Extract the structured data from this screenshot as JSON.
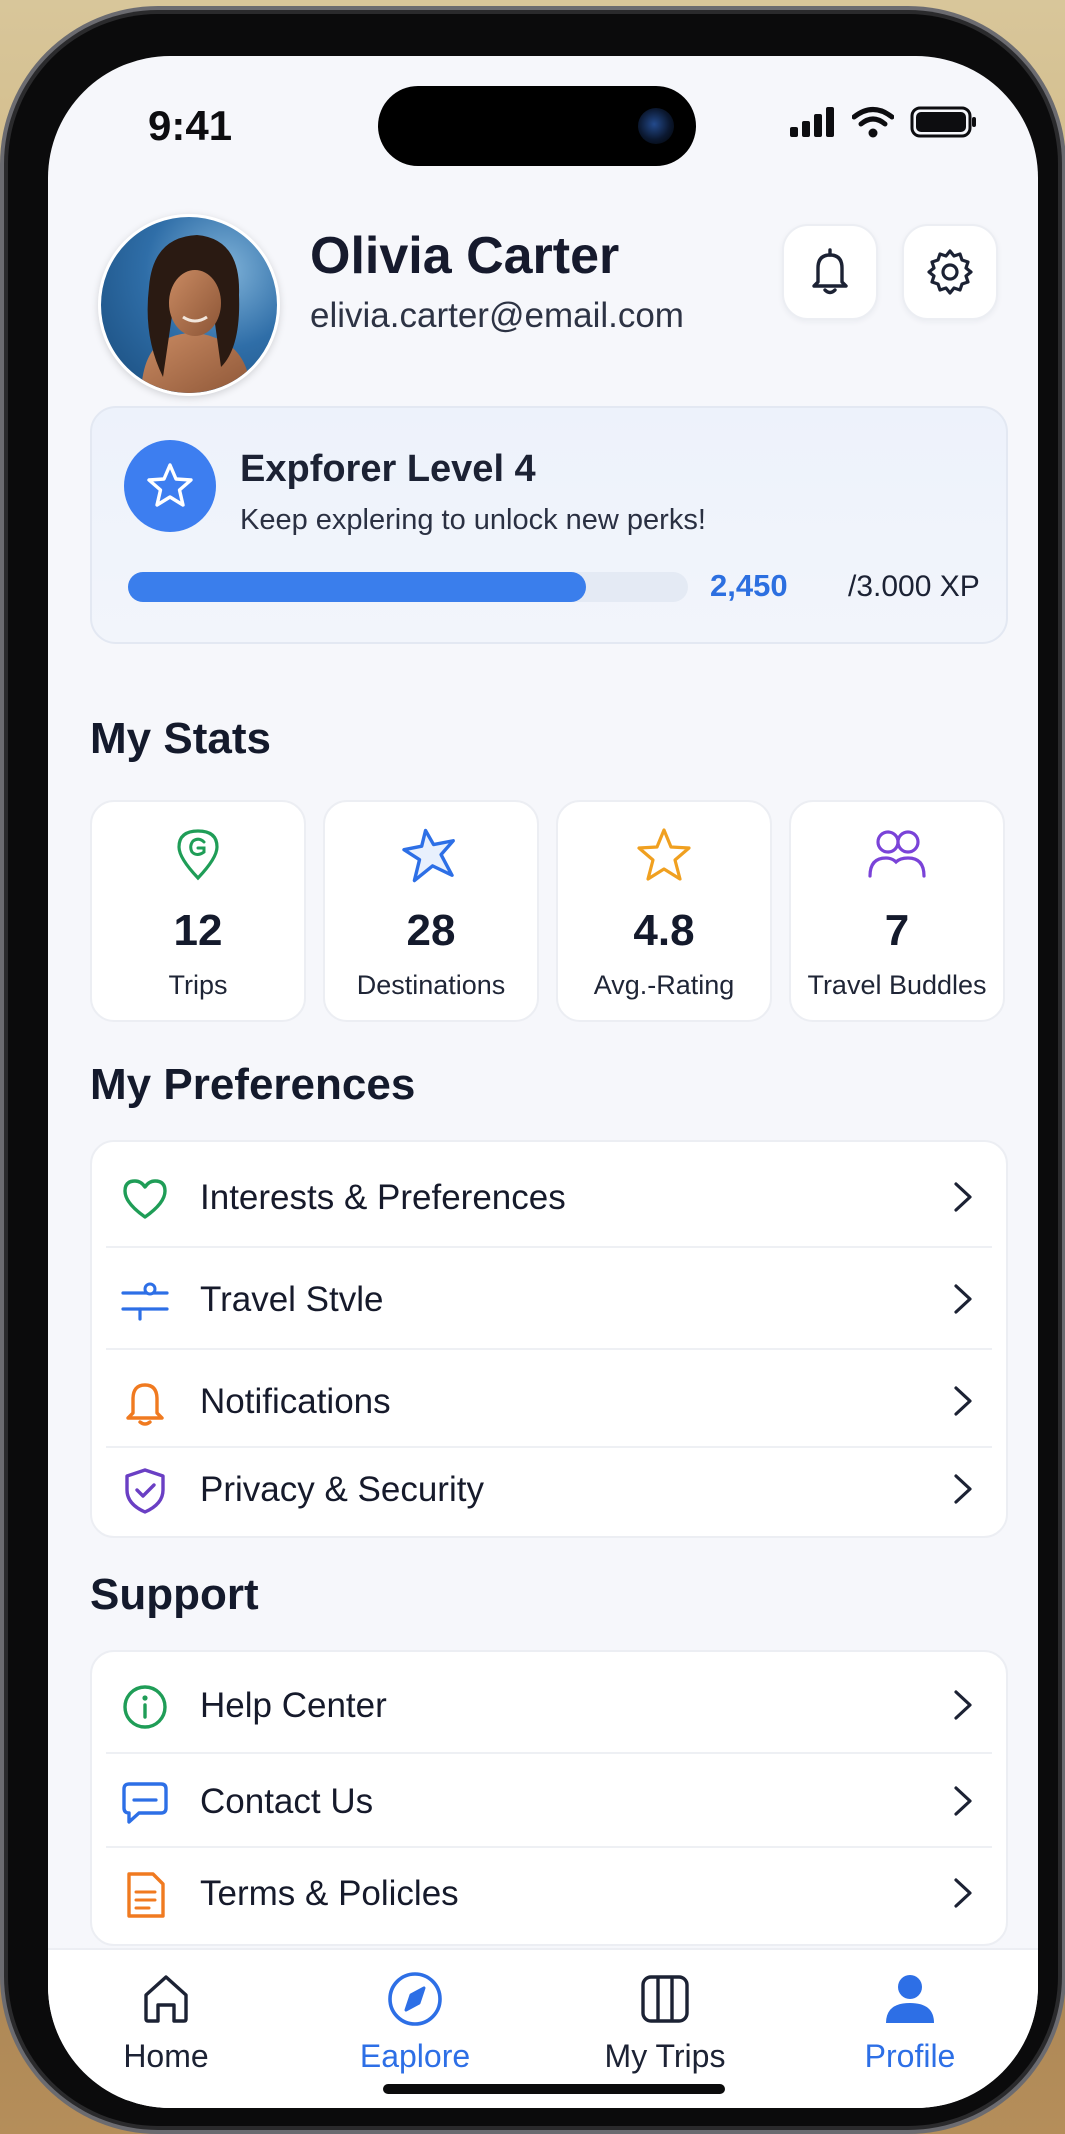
{
  "status_bar": {
    "time": "9:41"
  },
  "profile": {
    "name": "Olivia Carter",
    "email": "elivia.carter@email.com"
  },
  "header_actions": {
    "notifications_icon": "bell-icon",
    "settings_icon": "gear-icon"
  },
  "level": {
    "title": "Expforer Level 4",
    "subtitle": "Keep explering to unlock new perks!",
    "xp_current": "2,450",
    "xp_total": "/3.000 XP",
    "progress_fraction": 0.817,
    "accent": "#3a7eec"
  },
  "stats": {
    "title": "My Stats",
    "items": [
      {
        "icon": "location-pin-icon",
        "value": "12",
        "label": "Trips",
        "color": "#1f9d57"
      },
      {
        "icon": "star-icon",
        "value": "28",
        "label": "Destinations",
        "color": "#2d6fe6"
      },
      {
        "icon": "star-outline-icon",
        "value": "4.8",
        "label": "Avg.-Rating",
        "color": "#f0a020"
      },
      {
        "icon": "users-icon",
        "value": "7",
        "label": "Travel Buddles",
        "color": "#7a43d8"
      }
    ]
  },
  "preferences": {
    "title": "My Preferences",
    "items": [
      {
        "icon": "heart-icon",
        "label": "Interests & Preferences",
        "color": "#1f9d57"
      },
      {
        "icon": "sliders-icon",
        "label": "Travel Stvle",
        "color": "#2d6fe6"
      },
      {
        "icon": "bell-icon",
        "label": "Notifications",
        "color": "#f07a20"
      },
      {
        "icon": "shield-check-icon",
        "label": "Privacy & Security",
        "color": "#6a3fc4"
      }
    ]
  },
  "support": {
    "title": "Support",
    "items": [
      {
        "icon": "info-circle-icon",
        "label": "Help Center",
        "color": "#1f9d57"
      },
      {
        "icon": "chat-icon",
        "label": "Contact Us",
        "color": "#2d6fe6"
      },
      {
        "icon": "document-icon",
        "label": "Terms & Policles",
        "color": "#f07a20"
      }
    ]
  },
  "tabbar": {
    "items": [
      {
        "icon": "home-icon",
        "label": "Home",
        "active": false
      },
      {
        "icon": "compass-icon",
        "label": "Eaplore",
        "active": false,
        "highlight": true
      },
      {
        "icon": "map-icon",
        "label": "My Trips",
        "active": false
      },
      {
        "icon": "profile-icon",
        "label": "Profile",
        "active": true
      }
    ],
    "active_color": "#2d6fe6",
    "inactive_color": "#1c2234"
  }
}
